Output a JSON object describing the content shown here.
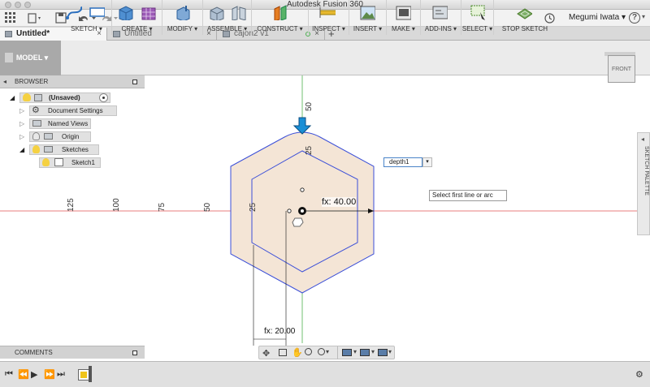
{
  "window": {
    "title": "Autodesk Fusion 360"
  },
  "app_toolbar": {
    "user_name": "Megumi Iwata",
    "help_label": "?"
  },
  "tabs": [
    {
      "label": "Untitled*",
      "close": "×"
    },
    {
      "label": "Untitled",
      "close": "×"
    },
    {
      "label": "cajon2 v1",
      "close": "×"
    },
    {
      "label": "+"
    }
  ],
  "ribbon": {
    "mode_label": "MODEL ▾",
    "groups": [
      {
        "label": "SKETCH ▾"
      },
      {
        "label": "CREATE ▾"
      },
      {
        "label": "MODIFY ▾"
      },
      {
        "label": "ASSEMBLE ▾"
      },
      {
        "label": "CONSTRUCT ▾"
      },
      {
        "label": "INSPECT ▾"
      },
      {
        "label": "INSERT ▾"
      },
      {
        "label": "MAKE ▾"
      },
      {
        "label": "ADD-INS ▾"
      },
      {
        "label": "SELECT ▾"
      },
      {
        "label": "STOP SKETCH"
      }
    ]
  },
  "viewcube": {
    "face_label": "FRONT"
  },
  "browser": {
    "header": "BROWSER",
    "items": [
      {
        "label": "(Unsaved)"
      },
      {
        "label": "Document Settings"
      },
      {
        "label": "Named Views"
      },
      {
        "label": "Origin"
      },
      {
        "label": "Sketches"
      },
      {
        "label": "Sketch1"
      }
    ]
  },
  "canvas": {
    "axis_ticks_horizontal": [
      "125",
      "100",
      "75",
      "50",
      "25"
    ],
    "axis_ticks_vertical": [
      "50",
      "25"
    ],
    "dimension_horizontal": "fx: 40.00",
    "dimension_bottom": "fx: 20.00",
    "depth_input_value": "depth1",
    "tooltip": "Select first line or arc"
  },
  "sketch_palette": {
    "label": "SKETCH PALETTE"
  },
  "comments": {
    "header": "COMMENTS"
  },
  "colors": {
    "ribbon_bg": "#ebebeb",
    "model_button_bg": "#a9a9a9",
    "axis_x": "#e05050",
    "axis_y": "#4cb24c",
    "profile_fill": "#f4e5d6",
    "sketch_line": "#3b4fd8",
    "accent_blue": "#1a8fd6"
  }
}
